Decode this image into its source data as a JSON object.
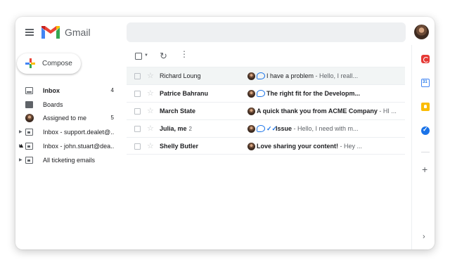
{
  "header": {
    "brand": "Gmail",
    "search_placeholder": ""
  },
  "compose": {
    "label": "Compose"
  },
  "nav": [
    {
      "label": "Inbox",
      "count": "4",
      "bold": true,
      "icon": "inbox-icon",
      "expandable": false
    },
    {
      "label": "Boards",
      "count": "",
      "bold": false,
      "icon": "boards-icon",
      "expandable": false
    },
    {
      "label": "Assigned to me",
      "count": "5",
      "bold": false,
      "icon": "avatar-icon",
      "expandable": false
    },
    {
      "label": "Inbox - support.dealet@...",
      "count": "",
      "bold": false,
      "icon": "shared-inbox-icon",
      "expandable": true
    },
    {
      "label": "Inbox - john.stuart@dea...",
      "count": "",
      "bold": false,
      "icon": "shared-inbox-icon",
      "expandable": true
    },
    {
      "label": "All ticketing emails",
      "count": "",
      "bold": false,
      "icon": "shared-inbox-icon",
      "expandable": true
    }
  ],
  "emails": [
    {
      "sender": "Richard Loung",
      "thread": "",
      "unread": false,
      "subject": "I have a problem",
      "preview": " - Hello, I reall...",
      "badges": [
        "avatar",
        "chat"
      ]
    },
    {
      "sender": "Patrice Bahranu",
      "thread": "",
      "unread": true,
      "subject": "The right fit for the Developm...",
      "preview": "",
      "badges": [
        "avatar",
        "chat"
      ]
    },
    {
      "sender": "March State",
      "thread": "",
      "unread": true,
      "subject": "A quick thank you from ACME Company",
      "preview": " - HI ...",
      "badges": [
        "avatar"
      ]
    },
    {
      "sender": "Julia, me",
      "thread": "2",
      "unread": true,
      "subject": "Issue",
      "preview": " - Hello, I need with m...",
      "badges": [
        "avatar",
        "chat",
        "double-check"
      ]
    },
    {
      "sender": "Shelly Butler",
      "thread": "",
      "unread": true,
      "subject": "Love sharing your content!",
      "preview": " - Hey ...",
      "badges": [
        "avatar"
      ]
    }
  ],
  "rail": {
    "calendar_label": "31"
  },
  "colors": {
    "accent": "#1a73e8",
    "gmail_red": "#ea4335",
    "keep_yellow": "#fbbc04",
    "selected_row": "#f2f5f5"
  }
}
